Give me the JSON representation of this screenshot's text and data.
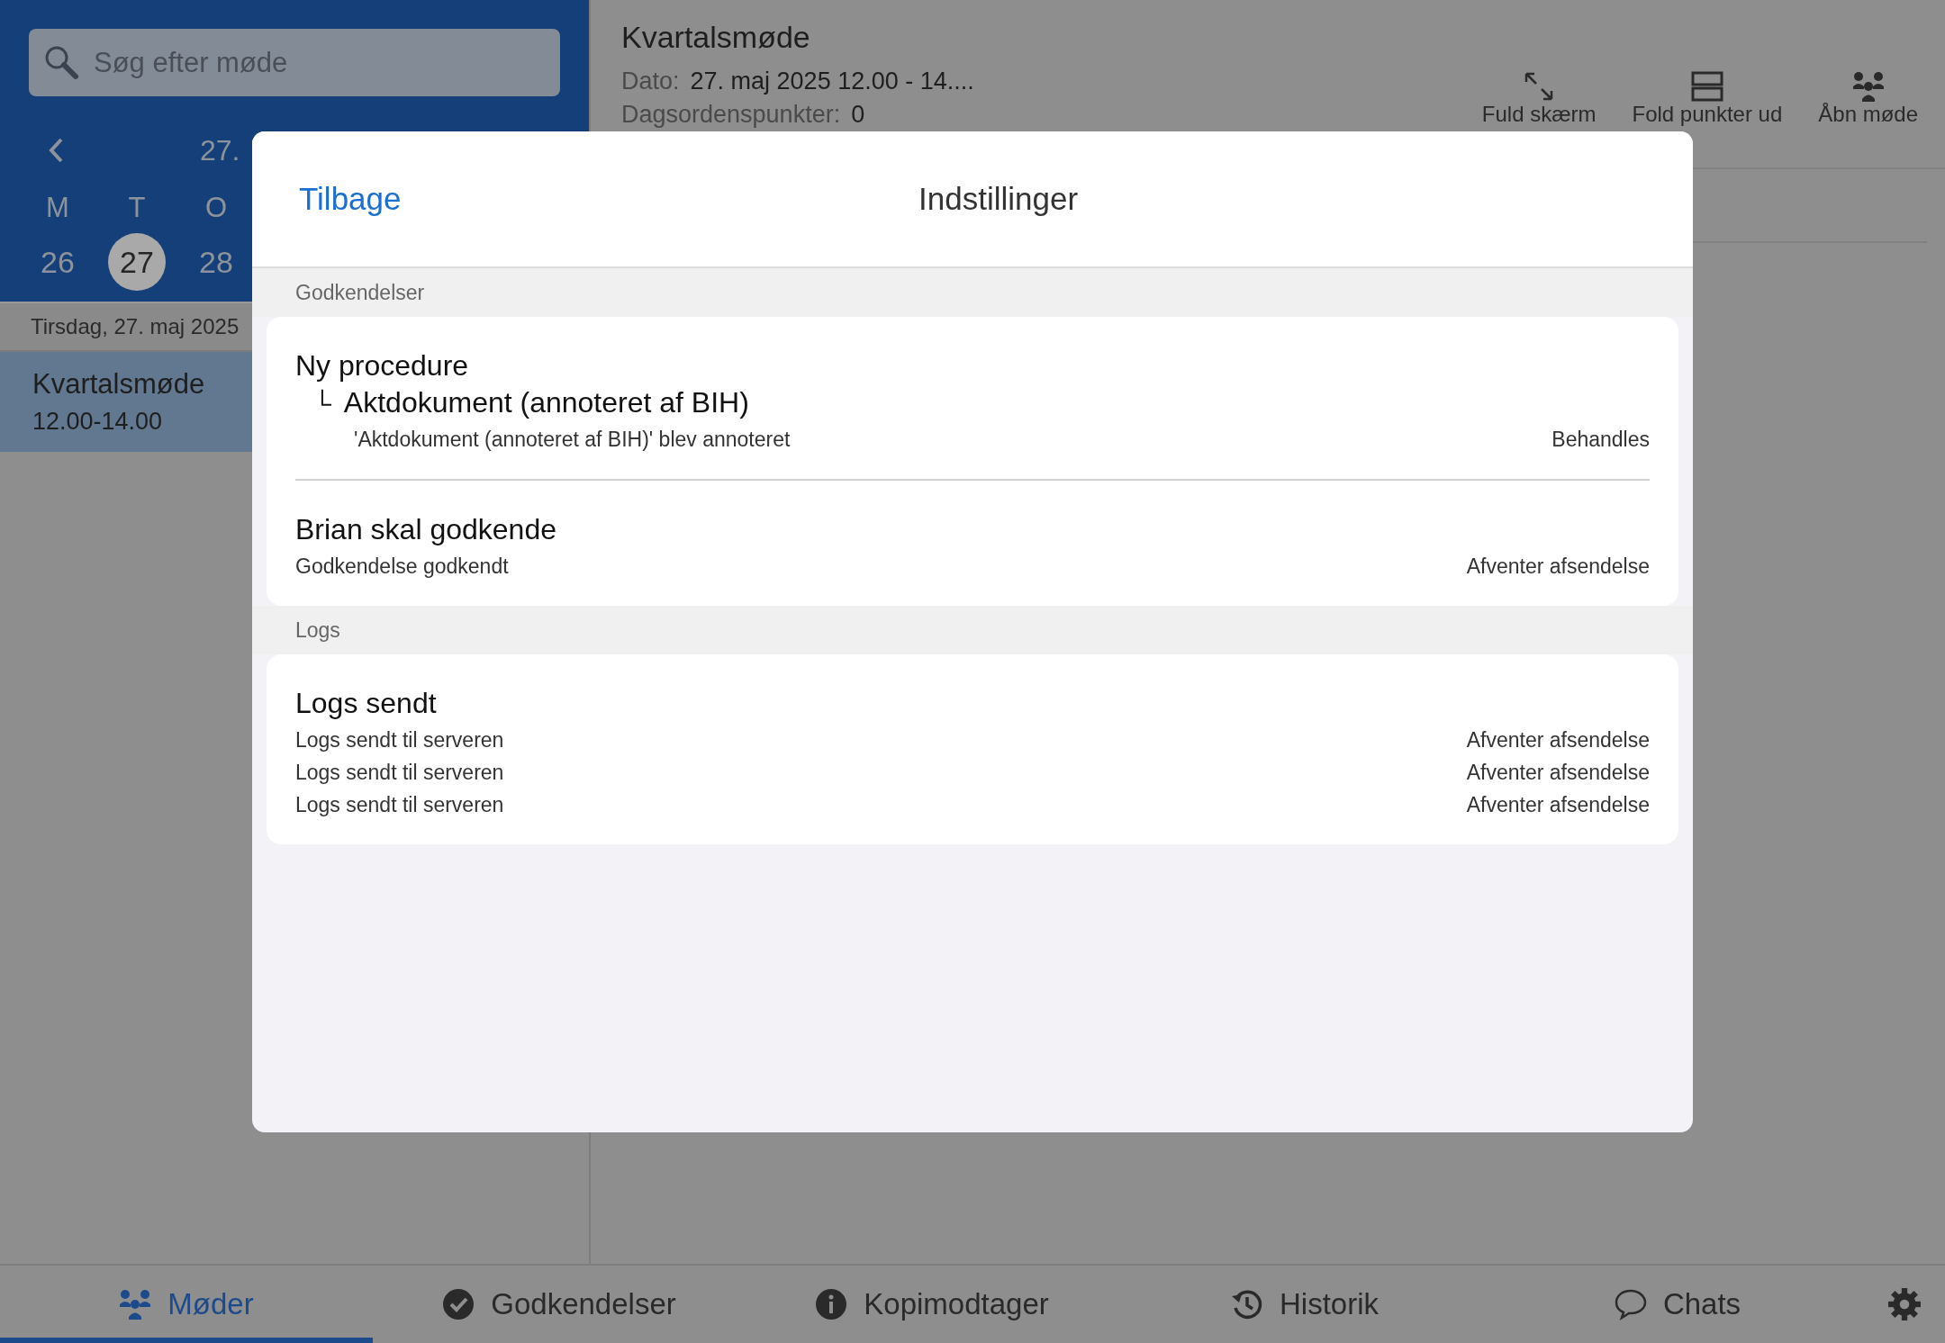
{
  "sidebar": {
    "search": {
      "placeholder": "Søg efter møde"
    },
    "calendar": {
      "month_label": "27.",
      "weekdays": [
        "M",
        "T",
        "O"
      ],
      "days": [
        {
          "label": "26",
          "selected": false
        },
        {
          "label": "27",
          "selected": true
        },
        {
          "label": "28",
          "selected": false
        }
      ]
    },
    "date_header": "Tirsdag, 27. maj 2025",
    "meetings": [
      {
        "title": "Kvartalsmøde",
        "time": "12.00-14.00",
        "selected": true
      }
    ]
  },
  "meeting": {
    "title": "Kvartalsmøde",
    "date_label": "Dato:",
    "date_value": "27. maj 2025 12.00 - 14....",
    "agenda_label": "Dagsordenspunkter:",
    "agenda_value": "0",
    "actions": [
      {
        "kind": "fullscreen",
        "label": "Fuld skærm"
      },
      {
        "kind": "expand",
        "label": "Fold punkter ud"
      },
      {
        "kind": "open",
        "label": "Åbn møde"
      }
    ]
  },
  "dialog": {
    "back": "Tilbage",
    "title": "Indstillinger",
    "sections": [
      {
        "header": "Godkendelser",
        "items": [
          {
            "title": "Ny procedure",
            "child": {
              "mark": "└",
              "title": "Aktdokument (annoteret af BIH)"
            },
            "lines": [
              {
                "text": "'Aktdokument (annoteret af BIH)' blev annoteret",
                "status": "Behandles"
              }
            ]
          },
          {
            "title": "Brian skal godkende",
            "lines": [
              {
                "text": "Godkendelse godkendt",
                "status": "Afventer afsendelse"
              }
            ]
          }
        ]
      },
      {
        "header": "Logs",
        "items": [
          {
            "title": "Logs sendt",
            "lines": [
              {
                "text": "Logs sendt til serveren",
                "status": "Afventer afsendelse"
              },
              {
                "text": "Logs sendt til serveren",
                "status": "Afventer afsendelse"
              },
              {
                "text": "Logs sendt til serveren",
                "status": "Afventer afsendelse"
              }
            ]
          }
        ]
      }
    ]
  },
  "tabbar": {
    "tabs": [
      {
        "kind": "meetings",
        "label": "Møder",
        "selected": true
      },
      {
        "kind": "approvals",
        "label": "Godkendelser",
        "selected": false
      },
      {
        "kind": "copy",
        "label": "Kopimodtager",
        "selected": false
      },
      {
        "kind": "history",
        "label": "Historik",
        "selected": false
      },
      {
        "kind": "chats",
        "label": "Chats",
        "selected": false
      }
    ]
  }
}
